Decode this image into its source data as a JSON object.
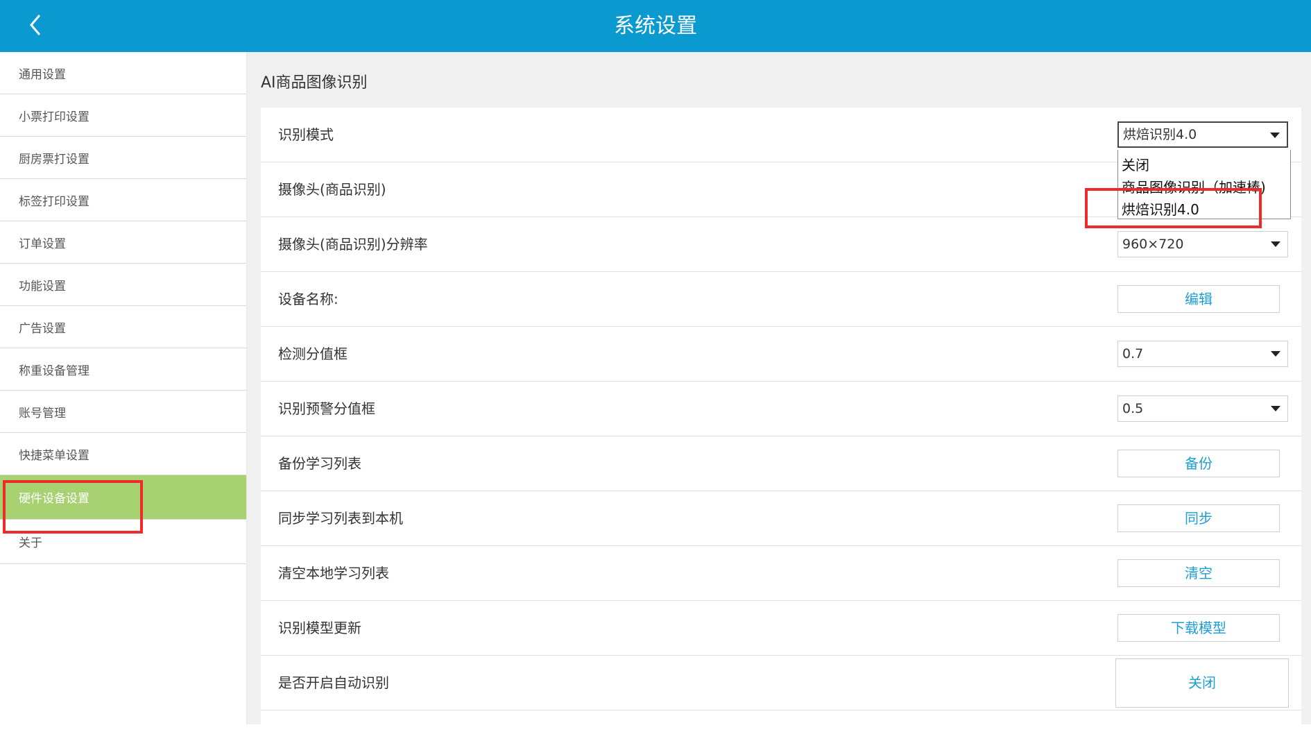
{
  "header": {
    "title": "系统设置"
  },
  "sidebar": {
    "items": [
      {
        "label": "通用设置"
      },
      {
        "label": "小票打印设置"
      },
      {
        "label": "厨房票打设置"
      },
      {
        "label": "标签打印设置"
      },
      {
        "label": "订单设置"
      },
      {
        "label": "功能设置"
      },
      {
        "label": "广告设置"
      },
      {
        "label": "称重设备管理"
      },
      {
        "label": "账号管理"
      },
      {
        "label": "快捷菜单设置"
      },
      {
        "label": "硬件设备设置"
      },
      {
        "label": "关于"
      }
    ],
    "active_label": "硬件设备设置"
  },
  "main": {
    "section_title": "AI商品图像识别",
    "rows": [
      {
        "label": "识别模式",
        "select_value": "烘焙识别4.0"
      },
      {
        "label": "摄像头(商品识别)"
      },
      {
        "label": "摄像头(商品识别)分辨率",
        "select_value": "960×720"
      },
      {
        "label": "设备名称:",
        "button": "编辑"
      },
      {
        "label": "检测分值框",
        "select_value": "0.7"
      },
      {
        "label": "识别预警分值框",
        "select_value": "0.5"
      },
      {
        "label": "备份学习列表",
        "button": "备份"
      },
      {
        "label": "同步学习列表到本机",
        "button": "同步"
      },
      {
        "label": "清空本地学习列表",
        "button": "清空"
      },
      {
        "label": "识别模型更新",
        "button": "下载模型"
      },
      {
        "label": "是否开启自动识别",
        "button": "关闭"
      }
    ],
    "dropdown": {
      "options": [
        "关闭",
        "商品图像识别（加速棒)",
        "烘焙识别4.0"
      ],
      "selected": "烘焙识别4.0"
    }
  },
  "colors": {
    "header_bg": "#0a9acf",
    "active_item_bg": "#a8d272",
    "button_text": "#1f9ed3",
    "highlight_box": "#ee2a2a"
  }
}
